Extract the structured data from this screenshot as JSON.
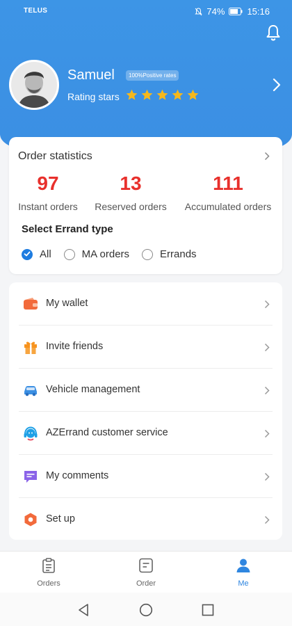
{
  "status_bar": {
    "carrier": "TELUS",
    "battery": "74%",
    "time": "15:16"
  },
  "profile": {
    "name": "Samuel",
    "badge": "100%Positive rates",
    "rating_label": "Rating stars",
    "stars": 5
  },
  "stats": {
    "title": "Order statistics",
    "items": [
      {
        "value": "97",
        "label": "Instant orders"
      },
      {
        "value": "13",
        "label": "Reserved orders"
      },
      {
        "value": "111",
        "label": "Accumulated orders"
      }
    ],
    "errand_title": "Select Errand type",
    "options": [
      {
        "label": "All",
        "checked": true
      },
      {
        "label": "MA orders",
        "checked": false
      },
      {
        "label": "Errands",
        "checked": false
      }
    ]
  },
  "menu": [
    {
      "label": "My wallet",
      "icon": "wallet-icon"
    },
    {
      "label": "Invite friends",
      "icon": "gift-icon"
    },
    {
      "label": "Vehicle management",
      "icon": "car-icon"
    },
    {
      "label": "AZErrand customer service",
      "icon": "headset-icon"
    },
    {
      "label": "My comments",
      "icon": "comment-icon"
    },
    {
      "label": "Set up",
      "icon": "settings-icon"
    }
  ],
  "tabs": [
    {
      "label": "Orders",
      "icon": "clipboard-icon",
      "active": false
    },
    {
      "label": "Order",
      "icon": "document-icon",
      "active": false
    },
    {
      "label": "Me",
      "icon": "person-icon",
      "active": true
    }
  ],
  "colors": {
    "brand": "#3b8fe3",
    "accent_red": "#e8302c",
    "star": "#f6b81c"
  }
}
